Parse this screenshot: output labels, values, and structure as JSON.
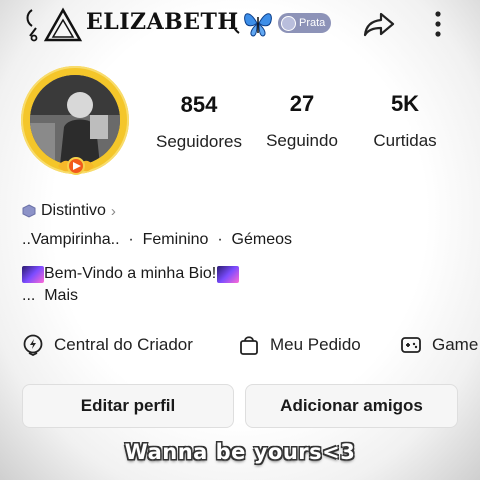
{
  "header": {
    "username": "ELIZABETH",
    "badge_label": "Prata",
    "icons": [
      "logo-mark-icon",
      "butterfly-icon",
      "badge-icon",
      "share-icon",
      "more-icon"
    ]
  },
  "stats": [
    {
      "value": "854",
      "label": "Seguidores"
    },
    {
      "value": "27",
      "label": "Seguindo"
    },
    {
      "value": "5K",
      "label": "Curtidas"
    }
  ],
  "bio": {
    "distintivo": "Distintivo",
    "tags_line": "..Vampirinha..  ·  Feminino  ·  Gémeos",
    "welcome": "Bem-Vindo a minha Bio!",
    "more": "...  Mais"
  },
  "tools": [
    {
      "label": "Central do Criador",
      "icon": "creator-center-icon"
    },
    {
      "label": "Meu Pedido",
      "icon": "shopping-bag-icon"
    },
    {
      "label": "Game",
      "icon": "gamepad-icon"
    }
  ],
  "buttons": {
    "edit_profile": "Editar perfil",
    "add_friends": "Adicionar amigos"
  },
  "caption": "Wanna be yours<3",
  "colors": {
    "avatar_ring": "#f4c62a",
    "badge": "#8d93b8",
    "accent_gradient": [
      "#6a3cff",
      "#ff5fd2"
    ]
  }
}
